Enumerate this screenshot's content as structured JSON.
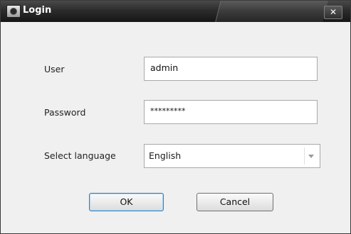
{
  "window": {
    "title": "Login",
    "close_label": "✕"
  },
  "form": {
    "user_label": "User",
    "user_value": "admin",
    "password_label": "Password",
    "password_value": "*********",
    "language_label": "Select language",
    "language_value": "English"
  },
  "buttons": {
    "ok_label": "OK",
    "cancel_label": "Cancel"
  }
}
